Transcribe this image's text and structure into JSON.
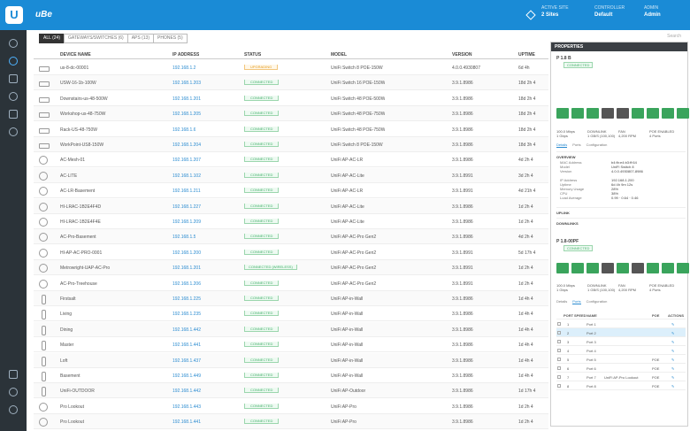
{
  "app": {
    "logo_letter": "U",
    "brand": "uBe",
    "top": [
      {
        "label": "ACTIVE SITE",
        "value": "2 Sites"
      },
      {
        "label": "CONTROLLER",
        "value": "Default"
      },
      {
        "label": "ADMIN",
        "value": "Admin"
      }
    ]
  },
  "tabs": [
    "ALL (24)",
    "GATEWAYS/SWITCHES (6)",
    "APS (13)",
    "PHONES (5)"
  ],
  "search_placeholder": "Search",
  "columns": [
    "DEVICE NAME",
    "IP ADDRESS",
    "STATUS",
    "MODEL",
    "VERSION",
    "UPTIME"
  ],
  "devices": [
    {
      "icon": "sw",
      "name": "us-8-dc-00001",
      "ip": "192.168.1.2",
      "status": "UPGRADING",
      "stype": "up",
      "model": "UniFi Switch 8 POE-150W",
      "version": "4.0.0.4930807",
      "uptime": "6d 4h"
    },
    {
      "icon": "sw",
      "name": "USW-16-1b-100W",
      "ip": "192.168.1.203",
      "status": "CONNECTED",
      "stype": "ok",
      "model": "UniFi Switch 16 POE-150W",
      "version": "3.9.1.8986",
      "uptime": "18d 2h 4"
    },
    {
      "icon": "sw",
      "name": "Downstairs-us-48-500W",
      "ip": "192.168.1.201",
      "status": "CONNECTED",
      "stype": "ok",
      "model": "UniFi Switch 48 POE-500W",
      "version": "3.9.1.8986",
      "uptime": "18d 2h 4"
    },
    {
      "icon": "sw",
      "name": "Workshop-us-48-750W",
      "ip": "192.168.1.205",
      "status": "CONNECTED",
      "stype": "ok",
      "model": "UniFi Switch 48 POE-750W",
      "version": "3.9.1.8986",
      "uptime": "18d 2h 4"
    },
    {
      "icon": "sw",
      "name": "Rack-US-48-750W",
      "ip": "192.168.1.6",
      "status": "CONNECTED",
      "stype": "ok",
      "model": "UniFi Switch 48 POE-750W",
      "version": "3.9.1.8986",
      "uptime": "18d 2h 4"
    },
    {
      "icon": "sw",
      "name": "WorkPoint-US8-150W",
      "ip": "192.168.1.204",
      "status": "CONNECTED",
      "stype": "ok",
      "model": "UniFi Switch 8 POE-150W",
      "version": "3.9.1.8986",
      "uptime": "18d 3h 4"
    },
    {
      "icon": "ap",
      "name": "AC-Mesh-01",
      "ip": "192.168.1.207",
      "status": "CONNECTED",
      "stype": "ok",
      "model": "UniFi AP-AC-LR",
      "version": "3.9.1.8986",
      "uptime": "4d 2h 4"
    },
    {
      "icon": "ap",
      "name": "AC-LITE",
      "ip": "192.168.1.102",
      "status": "CONNECTED",
      "stype": "ok",
      "model": "UniFi AP-AC-Lite",
      "version": "3.9.1.8991",
      "uptime": "3d 2h 4"
    },
    {
      "icon": "ap",
      "name": "AC-LR-Basement",
      "ip": "192.168.1.211",
      "status": "CONNECTED",
      "stype": "ok",
      "model": "UniFi AP-AC-LR",
      "version": "3.9.1.8991",
      "uptime": "4d 21h 4"
    },
    {
      "icon": "ap",
      "name": "HI-LRAC-1B2E4F4D",
      "ip": "192.168.1.227",
      "status": "CONNECTED",
      "stype": "ok",
      "model": "UniFi AP-AC-Lite",
      "version": "3.9.1.8986",
      "uptime": "1d 2h 4"
    },
    {
      "icon": "ap",
      "name": "HI-LRAC-1B2E4F4E",
      "ip": "192.168.1.209",
      "status": "CONNECTED",
      "stype": "ok",
      "model": "UniFi AP-AC-Lite",
      "version": "3.9.1.8986",
      "uptime": "1d 2h 4"
    },
    {
      "icon": "ap",
      "name": "AC-Pro-Basement",
      "ip": "192.168.1.5",
      "status": "CONNECTED",
      "stype": "ok",
      "model": "UniFi AP-AC-Pro Gen2",
      "version": "3.9.1.8986",
      "uptime": "4d 2h 4"
    },
    {
      "icon": "ap",
      "name": "HI-AP-AC-PRO-0001",
      "ip": "192.168.1.200",
      "status": "CONNECTED",
      "stype": "ok",
      "model": "UniFi AP-AC-Pro Gen2",
      "version": "3.9.1.8991",
      "uptime": "5d 17h 4"
    },
    {
      "icon": "ap",
      "name": "Metrowright-UAP-AC-Pro",
      "ip": "192.168.1.201",
      "status": "CONNECTED (WIRELESS)",
      "stype": "c",
      "model": "UniFi AP-AC-Pro Gen2",
      "version": "3.9.1.8991",
      "uptime": "1d 2h 4"
    },
    {
      "icon": "ap",
      "name": "AC-Pro-Treehouse",
      "ip": "192.168.1.206",
      "status": "CONNECTED",
      "stype": "ok",
      "model": "UniFi AP-AC-Pro Gen2",
      "version": "3.9.1.8991",
      "uptime": "1d 2h 4"
    },
    {
      "icon": "ou",
      "name": "Firstsalt",
      "ip": "192.168.1.225",
      "status": "CONNECTED",
      "stype": "ok",
      "model": "UniFi AP-in-Wall",
      "version": "3.9.1.8986",
      "uptime": "1d 4h 4"
    },
    {
      "icon": "ou",
      "name": "Living",
      "ip": "192.168.1.235",
      "status": "CONNECTED",
      "stype": "ok",
      "model": "UniFi AP-in-Wall",
      "version": "3.9.1.8986",
      "uptime": "1d 4h 4"
    },
    {
      "icon": "ou",
      "name": "Dining",
      "ip": "192.168.1.442",
      "status": "CONNECTED",
      "stype": "ok",
      "model": "UniFi AP-in-Wall",
      "version": "3.9.1.8986",
      "uptime": "1d 4h 4"
    },
    {
      "icon": "ou",
      "name": "Master",
      "ip": "192.168.1.441",
      "status": "CONNECTED",
      "stype": "ok",
      "model": "UniFi AP-in-Wall",
      "version": "3.9.1.8986",
      "uptime": "1d 4h 4"
    },
    {
      "icon": "ou",
      "name": "Loft",
      "ip": "192.168.1.437",
      "status": "CONNECTED",
      "stype": "ok",
      "model": "UniFi AP-in-Wall",
      "version": "3.9.1.8986",
      "uptime": "1d 4h 4"
    },
    {
      "icon": "ou",
      "name": "Basement",
      "ip": "192.168.1.449",
      "status": "CONNECTED",
      "stype": "ok",
      "model": "UniFi AP-in-Wall",
      "version": "3.9.1.8986",
      "uptime": "1d 4h 4"
    },
    {
      "icon": "ou",
      "name": "UniFi-OUTDOOR",
      "ip": "192.168.1.442",
      "status": "CONNECTED",
      "stype": "ok",
      "model": "UniFi AP-Outdoor",
      "version": "3.9.1.8986",
      "uptime": "1d 17h 4"
    },
    {
      "icon": "ap",
      "name": "Pro Lookout",
      "ip": "192.168.1.443",
      "status": "CONNECTED",
      "stype": "ok",
      "model": "UniFi AP-Pro",
      "version": "3.9.1.8986",
      "uptime": "1d 2h 4"
    },
    {
      "icon": "ap",
      "name": "Pro Lookout",
      "ip": "192.168.1.441",
      "status": "CONNECTED",
      "stype": "ok",
      "model": "UniFi AP-Pro",
      "version": "3.9.1.8986",
      "uptime": "1d 2h 4"
    }
  ],
  "panel": {
    "header": "PROPERTIES",
    "dev1": {
      "title": "P 1.8 B",
      "badge": "CONNECTED",
      "ports": [
        "g",
        "g",
        "g",
        "d",
        "d",
        "g",
        "g",
        "g",
        "g"
      ],
      "stats": [
        "100.0 Mbps",
        "DOWNLINK",
        "FAN",
        "POE ENABLED",
        "1 Gbps",
        "1 GB/S (100,100)",
        "4,200 RPM",
        "4 Ports"
      ],
      "subtabs": [
        "Details",
        "Ports",
        "Configuration"
      ],
      "section": "OVERVIEW",
      "kv": [
        [
          "MAC Address",
          "b4:fb:e4:b3:ff:64"
        ],
        [
          "Model",
          "UniFi Switch 8"
        ],
        [
          "Version",
          "4.0.0.4930807-8986"
        ],
        [
          "",
          ""
        ],
        [
          "IP Address",
          "192.168.1.200"
        ],
        [
          "Uptime",
          "6d 4h 9m 12s"
        ],
        [
          "Memory Usage",
          "28%"
        ],
        [
          "CPU",
          "38%"
        ],
        [
          "Load Average",
          "0.99 · 0.64 · 0.46"
        ]
      ],
      "sec2": "UPLINK",
      "sec3": "DOWNLINKS"
    },
    "dev2": {
      "title": "P 1.8-00PF",
      "badge": "CONNECTED",
      "ports": [
        "g",
        "g",
        "g",
        "d",
        "g",
        "d",
        "g",
        "g",
        "g"
      ],
      "stats": [
        "100.0 Mbps",
        "DOWNLINK",
        "FAN",
        "POE ENABLED",
        "1 Gbps",
        "1 GB/S (100,100)",
        "4,200 RPM",
        "4 Ports"
      ],
      "subtabs": [
        "Details",
        "Ports",
        "Configuration"
      ],
      "port_head": [
        "PORT",
        "SPEED",
        "NAME",
        "POE",
        "ACTIONS"
      ],
      "ports_list": [
        [
          "1",
          "Port 1",
          "",
          ""
        ],
        [
          "2",
          "Port 2",
          "",
          ""
        ],
        [
          "3",
          "Port 3",
          "",
          ""
        ],
        [
          "4",
          "Port 4",
          "",
          ""
        ],
        [
          "5",
          "Port 5",
          "",
          "POE"
        ],
        [
          "6",
          "Port 6",
          "",
          "POE"
        ],
        [
          "7",
          "Port 7",
          "UniFi AP-Pro Lookout",
          "POE"
        ],
        [
          "8",
          "Port 8",
          "",
          "POE"
        ]
      ]
    }
  }
}
